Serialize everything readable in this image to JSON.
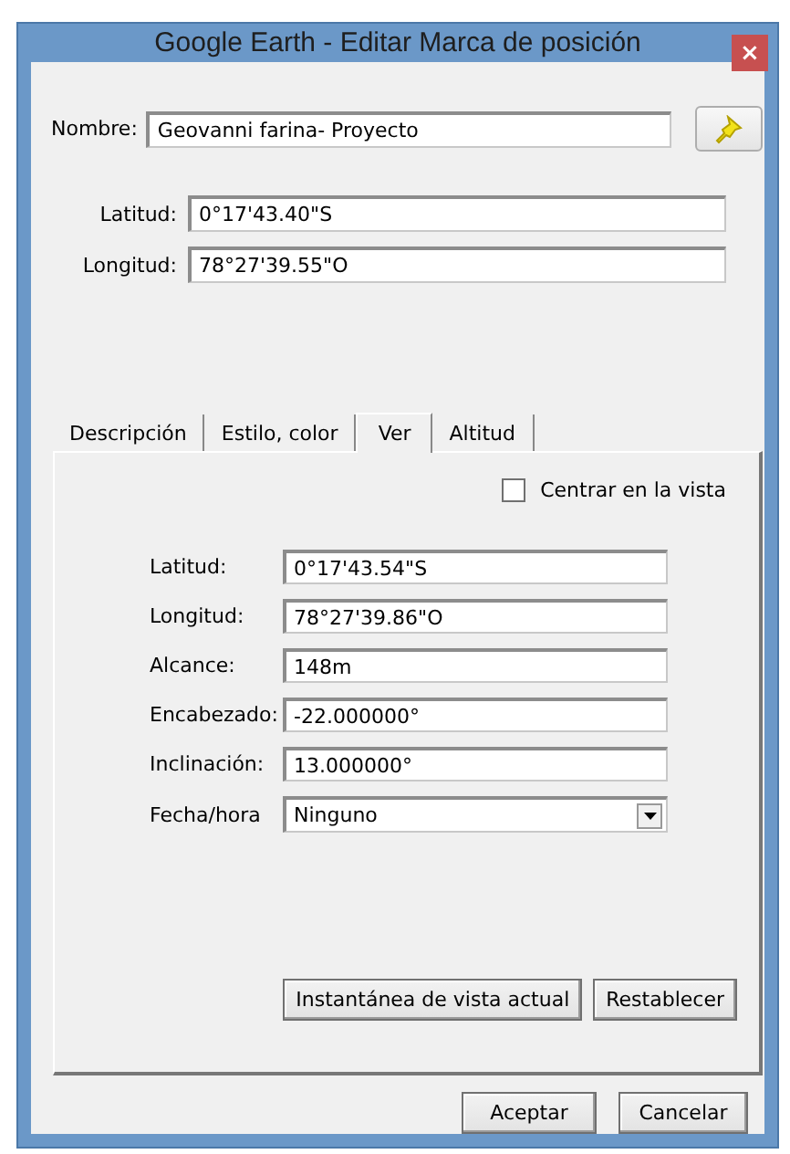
{
  "window": {
    "title": "Google Earth - Editar Marca de posición",
    "close": "×"
  },
  "name_field": {
    "label": "Nombre:",
    "value": "Geovanni farina- Proyecto"
  },
  "coordinates": [
    {
      "label": "Latitud:",
      "value": "0°17'43.40\"S"
    },
    {
      "label": "Longitud:",
      "value": "78°27'39.55\"O"
    }
  ],
  "tabs": [
    {
      "label": "Descripción",
      "selected": false
    },
    {
      "label": "Estilo, color",
      "selected": false
    },
    {
      "label": "Ver",
      "selected": true
    },
    {
      "label": "Altitud",
      "selected": false
    }
  ],
  "center_in_view": {
    "label": "Centrar en la vista",
    "checked": false
  },
  "view_fields": [
    {
      "kind": "text",
      "label": "Latitud:",
      "value": "0°17'43.54\"S"
    },
    {
      "kind": "text",
      "label": "Longitud:",
      "value": "78°27'39.86\"O"
    },
    {
      "kind": "text",
      "label": "Alcance:",
      "value": "148m"
    },
    {
      "kind": "text",
      "label": "Encabezado:",
      "value": "-22.000000°"
    },
    {
      "kind": "text",
      "label": "Inclinación:",
      "value": "13.000000°"
    },
    {
      "kind": "dropdown",
      "label": "Fecha/hora",
      "value": "Ninguno"
    }
  ],
  "view_buttons": [
    "Instantánea de vista actual",
    "Restablecer"
  ],
  "buttons": [
    "Aceptar",
    "Cancelar"
  ]
}
